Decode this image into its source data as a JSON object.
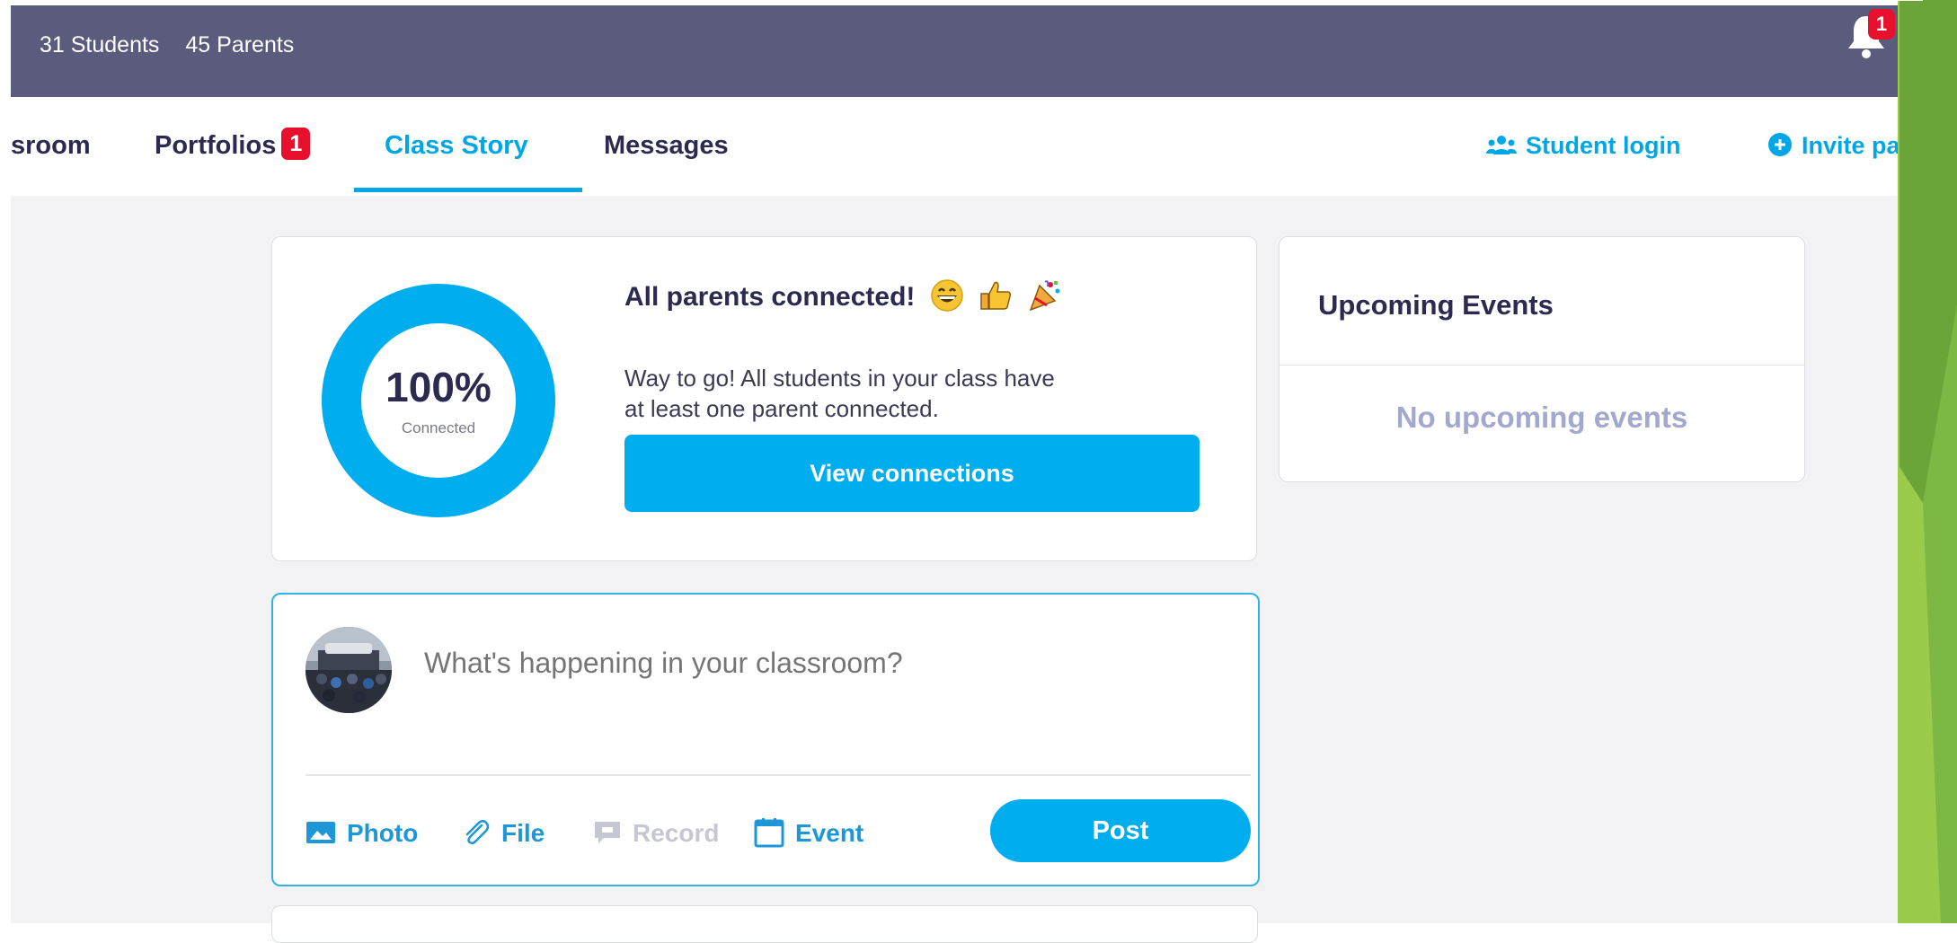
{
  "topbar": {
    "students_count": "31 Students",
    "parents_count": "45 Parents",
    "notification_badge": "1"
  },
  "nav": {
    "tabs": [
      {
        "label": "sroom"
      },
      {
        "label": "Portfolios",
        "badge": "1"
      },
      {
        "label": "Class Story",
        "active": true
      },
      {
        "label": "Messages"
      }
    ],
    "student_login": "Student login",
    "invite_parents": "Invite pare"
  },
  "connections_card": {
    "percent": "100%",
    "percent_label": "Connected",
    "percent_value": 1.0,
    "headline": "All parents connected!",
    "emojis": [
      "grinning-face",
      "thumbs-up",
      "party-popper"
    ],
    "description": "Way to go! All students in your class have at least one parent connected.",
    "button_label": "View connections"
  },
  "events_card": {
    "title": "Upcoming Events",
    "empty_text": "No upcoming events"
  },
  "composer": {
    "placeholder": "What's happening in your classroom?",
    "tools": [
      {
        "label": "Photo",
        "icon": "image-icon",
        "enabled": true
      },
      {
        "label": "File",
        "icon": "paperclip-icon",
        "enabled": true
      },
      {
        "label": "Record",
        "icon": "speech-bubble-icon",
        "enabled": false
      },
      {
        "label": "Event",
        "icon": "calendar-icon",
        "enabled": true
      }
    ],
    "post_label": "Post"
  },
  "colors": {
    "topbar": "#5b5c7d",
    "accent": "#00aeef",
    "badge": "#e8112d",
    "text_dark": "#2c2a50",
    "muted": "#a3a8cf",
    "background": "#f3f3f6"
  }
}
